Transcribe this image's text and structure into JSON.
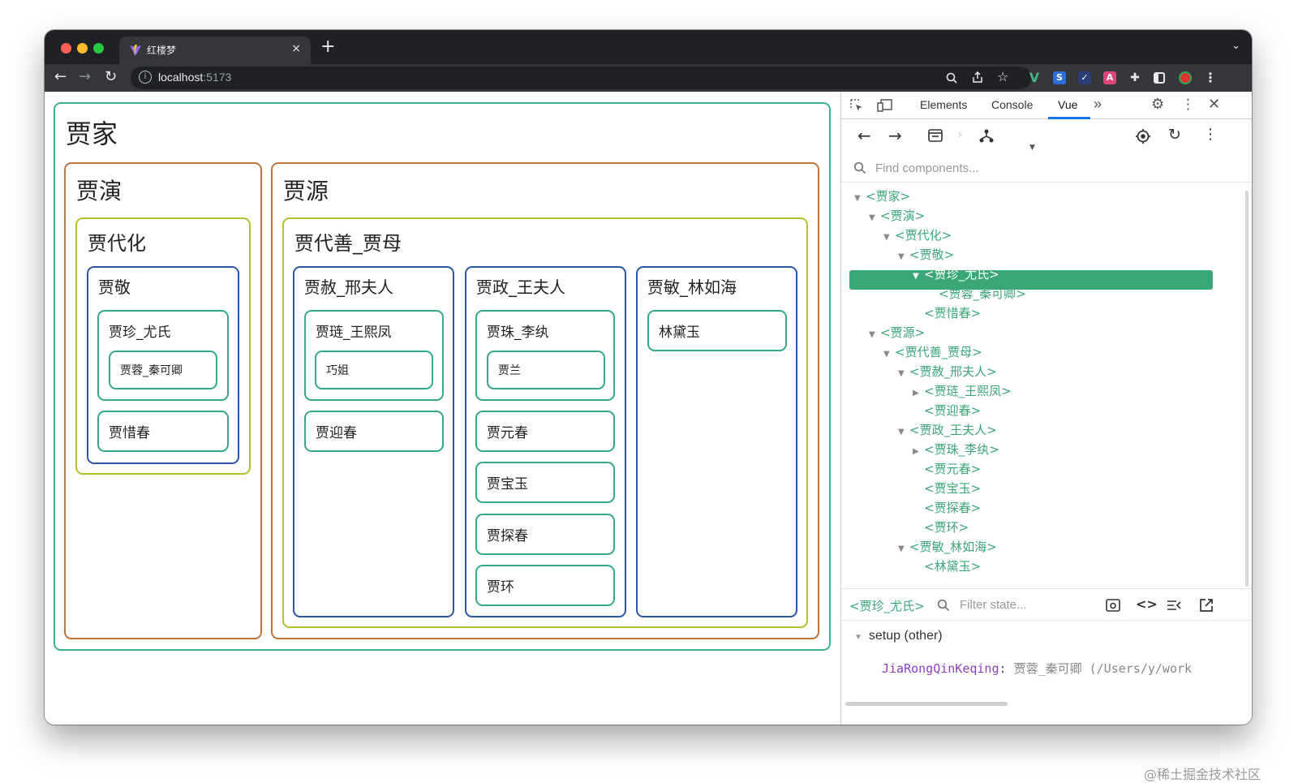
{
  "browser": {
    "tab_title": "红楼梦",
    "url_host": "localhost",
    "url_port": ":5173",
    "new_tab": "+",
    "close_tab": "×"
  },
  "app": {
    "jiajia": "贾家",
    "jiayan": "贾演",
    "jiadaihua": "贾代化",
    "jiajing": "贾敬",
    "jiazhen": "贾珍_尤氏",
    "jiarong": "贾蓉_秦可卿",
    "jiaxichun": "贾惜春",
    "jiayuan": "贾源",
    "jiadaishan": "贾代善_贾母",
    "jiashe": "贾赦_邢夫人",
    "jialian": "贾琏_王熙凤",
    "qiaojie": "巧姐",
    "jiayingchun": "贾迎春",
    "jiazheng": "贾政_王夫人",
    "jiazhu": "贾珠_李纨",
    "jialan": "贾兰",
    "jiayuanchun": "贾元春",
    "jiabaoyu": "贾宝玉",
    "jiatanchun": "贾探春",
    "jiahuan": "贾环",
    "jiamin": "贾敏_林如海",
    "lindaiyu": "林黛玉"
  },
  "devtools": {
    "tabs": [
      "Elements",
      "Console",
      "Vue",
      "»"
    ],
    "search_placeholder": "Find components...",
    "tree": [
      "<贾家>",
      "<贾演>",
      "<贾代化>",
      "<贾敬>",
      "<贾珍_尤氏>",
      "<贾蓉_秦可卿>",
      "<贾惜春>",
      "<贾源>",
      "<贾代善_贾母>",
      "<贾赦_邢夫人>",
      "<贾琏_王熙凤>",
      "<贾迎春>",
      "<贾政_王夫人>",
      "<贾珠_李纨>",
      "<贾元春>",
      "<贾宝玉>",
      "<贾探春>",
      "<贾环>",
      "<贾敏_林如海>",
      "<林黛玉>"
    ],
    "selected_component": "<贾珍_尤氏>",
    "filter_placeholder": "Filter state...",
    "setup_label": "setup (other)",
    "state_key": "JiaRongQinKeqing",
    "state_value": "贾蓉_秦可卿 (/Users/y/work"
  },
  "watermark": "@稀土掘金技术社区",
  "colors": {
    "vue_green": "#3ba776",
    "border_level1": "#3bb38b",
    "border_level2": "#c2723c",
    "border_level3": "#b4c12d",
    "border_level4": "#2b57a6",
    "border_level5": "#33a88a"
  }
}
